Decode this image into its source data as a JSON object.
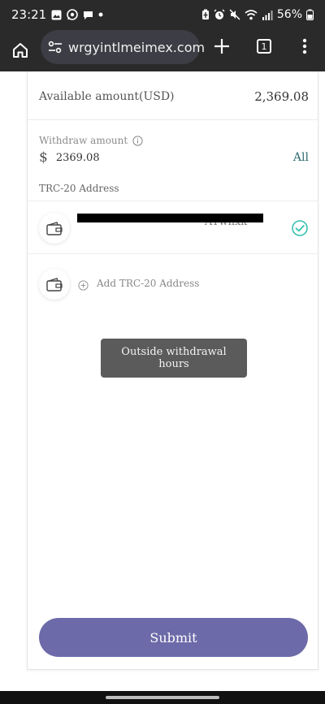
{
  "status_bar": {
    "time": "23:21",
    "battery": "56%",
    "left_icons": [
      "image-icon",
      "whatsapp-icon",
      "chat-icon",
      "dot-icon"
    ],
    "right_icons": [
      "battery-saver-icon",
      "alarm-icon",
      "mute-icon",
      "wifi-icon",
      "signal-icon",
      "battery-icon"
    ]
  },
  "browser": {
    "url": "wrgyintlmeimex.com",
    "tab_count": "1"
  },
  "form": {
    "available_label": "Available amount(USD)",
    "available_value": "2,369.08",
    "withdraw_label": "Withdraw amount",
    "currency_symbol": "$",
    "withdraw_value": "2369.08",
    "all_label": "All",
    "trc_title": "TRC-20 Address",
    "address_text": "                                      AYwhxk",
    "add_address_label": "Add TRC-20 Address",
    "submit_label": "Submit"
  },
  "toast": {
    "message": "Outside withdrawal hours"
  },
  "colors": {
    "accent": "#6c6aa8",
    "check": "#35c2b0",
    "all_link": "#2f6b6f",
    "toast_bg": "#5b5b5b"
  }
}
